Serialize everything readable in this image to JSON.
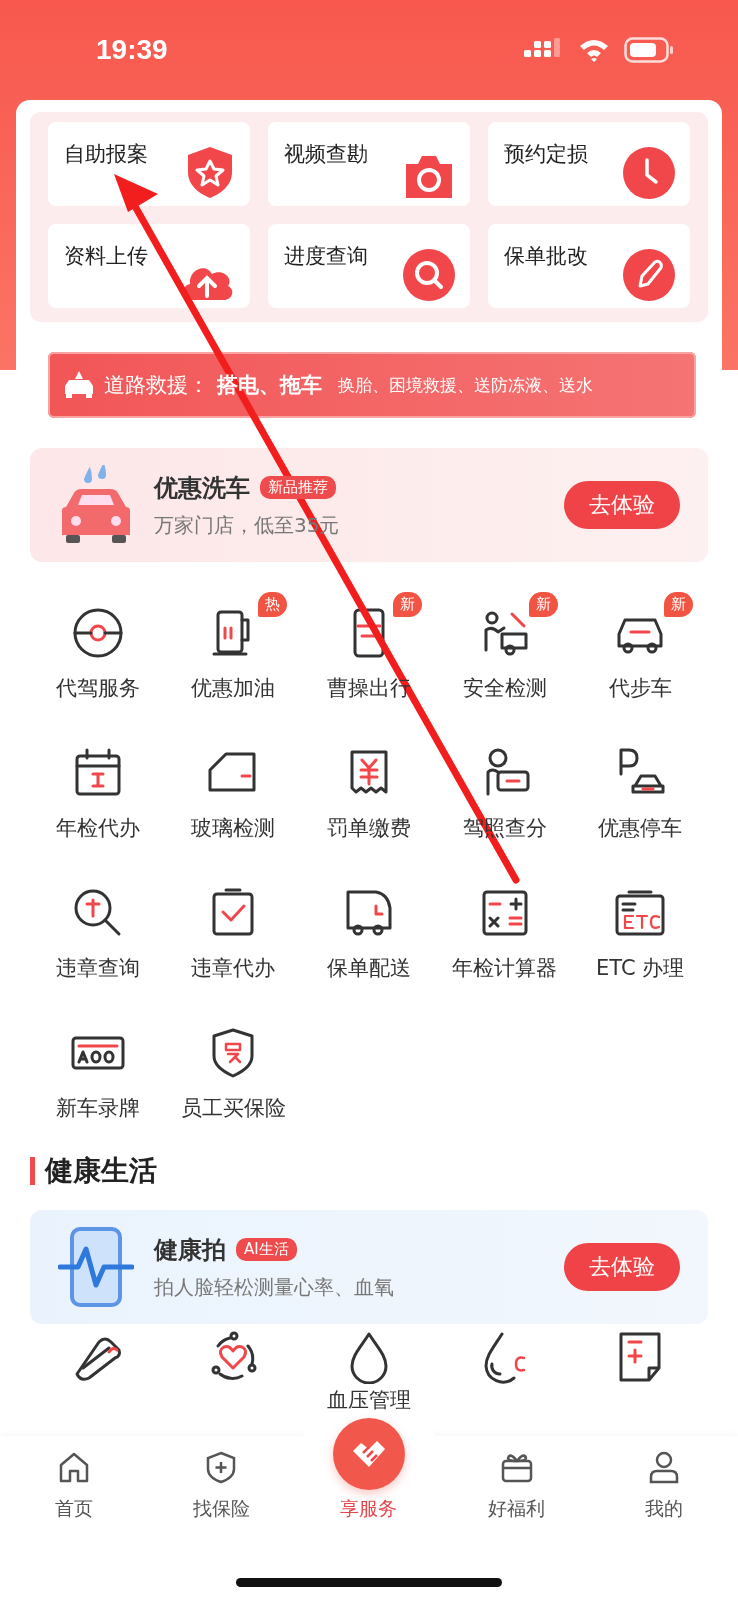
{
  "status_bar": {
    "time": "19:39"
  },
  "quick_actions": [
    {
      "label": "自助报案"
    },
    {
      "label": "视频查勘"
    },
    {
      "label": "预约定损"
    },
    {
      "label": "资料上传"
    },
    {
      "label": "进度查询"
    },
    {
      "label": "保单批改"
    }
  ],
  "rescue_banner": {
    "title": "道路救援：",
    "highlight": "搭电、拖车",
    "services": "换胎、困境救援、送防冻液、送水"
  },
  "car_wash": {
    "title": "优惠洗车",
    "badge": "新品推荐",
    "subtitle": "万家门店，低至35元",
    "button": "去体验"
  },
  "services": [
    {
      "label": "代驾服务"
    },
    {
      "label": "优惠加油",
      "badge": "热"
    },
    {
      "label": "曹操出行",
      "badge": "新"
    },
    {
      "label": "安全检测",
      "badge": "新"
    },
    {
      "label": "代步车",
      "badge": "新"
    },
    {
      "label": "年检代办"
    },
    {
      "label": "玻璃检测"
    },
    {
      "label": "罚单缴费"
    },
    {
      "label": "驾照查分"
    },
    {
      "label": "优惠停车"
    },
    {
      "label": "违章查询"
    },
    {
      "label": "违章代办"
    },
    {
      "label": "保单配送"
    },
    {
      "label": "年检计算器"
    },
    {
      "label": "ETC 办理"
    },
    {
      "label": "新车录牌"
    },
    {
      "label": "员工买保险"
    }
  ],
  "health": {
    "title": "健康生活",
    "card": {
      "title": "健康拍",
      "badge": "AI生活",
      "subtitle": "拍人脸轻松测量心率、血氧",
      "button": "去体验"
    },
    "grid_label": "血压管理"
  },
  "tabs": [
    {
      "label": "首页",
      "selected": false
    },
    {
      "label": "找保险",
      "selected": false
    },
    {
      "label": "享服务",
      "selected": true
    },
    {
      "label": "好福利",
      "selected": false
    },
    {
      "label": "我的",
      "selected": false
    }
  ]
}
